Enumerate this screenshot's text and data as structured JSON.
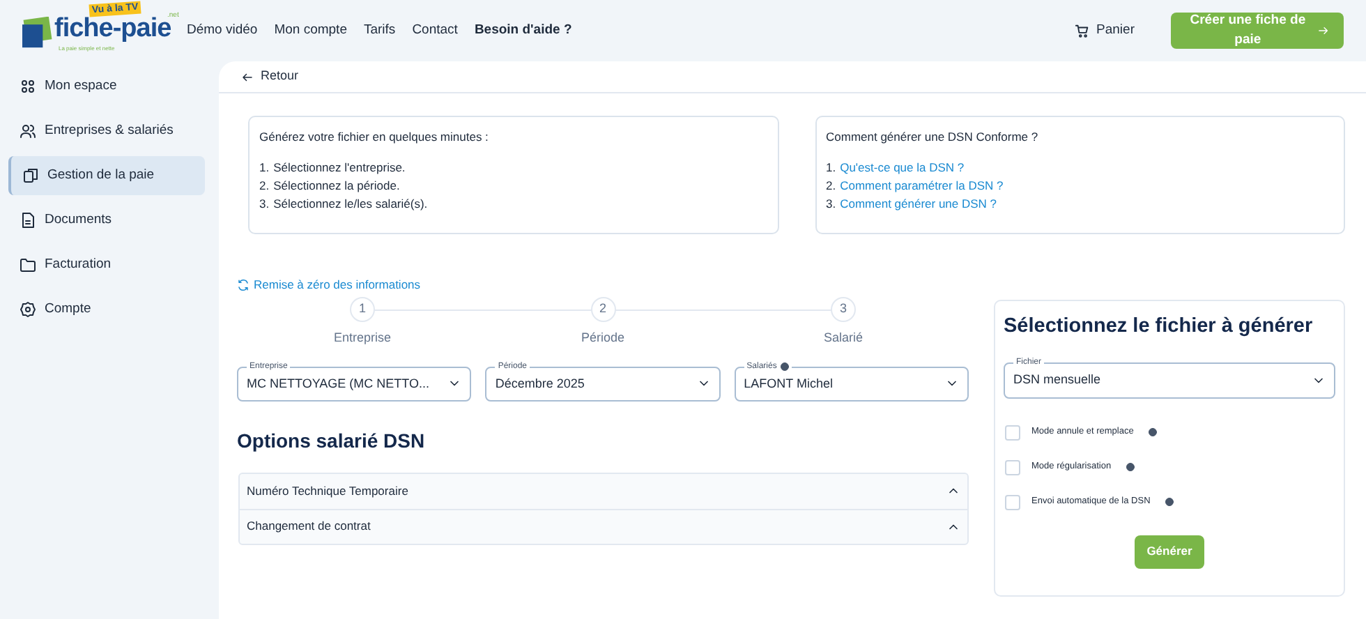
{
  "logo": {
    "name": "fiche-paie",
    "badge": "Vu à la TV",
    "suffix": ".net",
    "tagline": "La paie simple et nette"
  },
  "nav": [
    {
      "label": "Démo vidéo",
      "bold": false
    },
    {
      "label": "Mon compte",
      "bold": false
    },
    {
      "label": "Tarifs",
      "bold": false
    },
    {
      "label": "Contact",
      "bold": false
    },
    {
      "label": "Besoin d'aide ?",
      "bold": true
    }
  ],
  "cart": "Panier",
  "cta": "Créer une fiche de paie",
  "sidebar": {
    "items": [
      {
        "label": "Mon espace",
        "selected": false
      },
      {
        "label": "Entreprises & salariés",
        "selected": false
      },
      {
        "label": "Gestion de la paie",
        "selected": true
      },
      {
        "label": "Documents",
        "selected": false
      },
      {
        "label": "Facturation",
        "selected": false
      },
      {
        "label": "Compte",
        "selected": false
      }
    ]
  },
  "back": "Retour",
  "info_cards": [
    {
      "title": "Générez votre fichier en quelques minutes :",
      "links": false,
      "items": [
        {
          "number": "1.",
          "text": "Sélectionnez l'entreprise."
        },
        {
          "number": "2.",
          "text": "Sélectionnez la période."
        },
        {
          "number": "3.",
          "text": "Sélectionnez le/les salarié(s)."
        }
      ]
    },
    {
      "title": "Comment générer une DSN Conforme ?",
      "links": true,
      "items": [
        {
          "number": "1.",
          "text": "Qu'est-ce que la DSN ?"
        },
        {
          "number": "2.",
          "text": "Comment paramétrer la DSN ?"
        },
        {
          "number": "3.",
          "text": "Comment générer une DSN ?"
        }
      ]
    }
  ],
  "reset": "Remise à zéro des informations",
  "steps": [
    {
      "number": "1",
      "label": "Entreprise"
    },
    {
      "number": "2",
      "label": "Période"
    },
    {
      "number": "3",
      "label": "Salarié"
    }
  ],
  "selects": [
    {
      "label": "Entreprise",
      "value": "MC NETTOYAGE (MC NETTO...",
      "help": false
    },
    {
      "label": "Période",
      "value": "Décembre 2025",
      "help": false
    },
    {
      "label": "Salariés",
      "value": "LAFONT Michel",
      "help": true
    }
  ],
  "options_title": "Options salarié DSN",
  "accordion": [
    {
      "label": "Numéro Technique Temporaire",
      "expanded": false
    },
    {
      "label": "Changement de contrat",
      "expanded": false
    }
  ],
  "file_panel": {
    "title": "Sélectionnez le fichier à générer",
    "select": {
      "label": "Fichier",
      "value": "DSN mensuelle"
    },
    "checkboxes": [
      {
        "label": "Mode annule et remplace",
        "checked": false
      },
      {
        "label": "Mode régularisation",
        "checked": false
      },
      {
        "label": "Envoi automatique de la DSN",
        "checked": false
      }
    ],
    "button": "Générer"
  }
}
